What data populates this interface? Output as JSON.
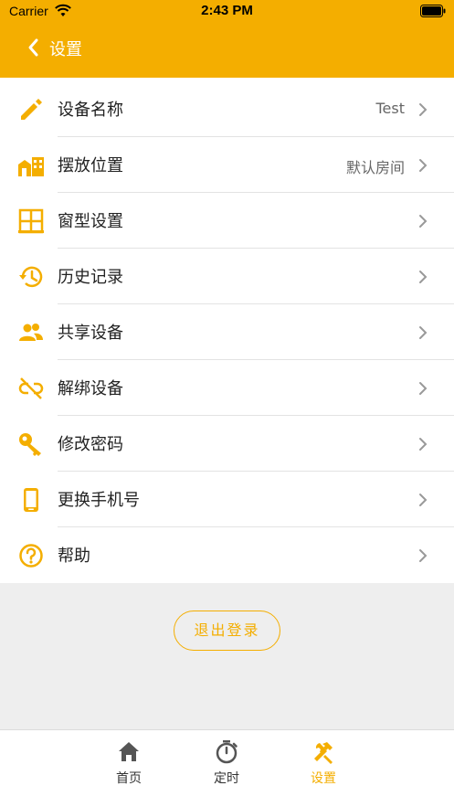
{
  "status_bar": {
    "carrier": "Carrier",
    "time": "2:43 PM"
  },
  "header": {
    "title": "设置"
  },
  "settings": [
    {
      "label": "设备名称",
      "value": "Test",
      "icon": "pencil-icon"
    },
    {
      "label": "摆放位置",
      "value": "默认房间",
      "icon": "building-icon"
    },
    {
      "label": "窗型设置",
      "value": "",
      "icon": "window-icon"
    },
    {
      "label": "历史记录",
      "value": "",
      "icon": "history-icon"
    },
    {
      "label": "共享设备",
      "value": "",
      "icon": "people-icon"
    },
    {
      "label": "解绑设备",
      "value": "",
      "icon": "unlink-icon"
    },
    {
      "label": "修改密码",
      "value": "",
      "icon": "key-icon"
    },
    {
      "label": "更换手机号",
      "value": "",
      "icon": "phone-icon"
    },
    {
      "label": "帮助",
      "value": "",
      "icon": "help-icon"
    }
  ],
  "logout": {
    "label": "退出登录"
  },
  "tabs": [
    {
      "label": "首页",
      "icon": "home-icon",
      "active": false
    },
    {
      "label": "定时",
      "icon": "timer-icon",
      "active": false
    },
    {
      "label": "设置",
      "icon": "tools-icon",
      "active": true
    }
  ],
  "colors": {
    "accent": "#F4AE00",
    "background_gray": "#EEEEEE"
  }
}
